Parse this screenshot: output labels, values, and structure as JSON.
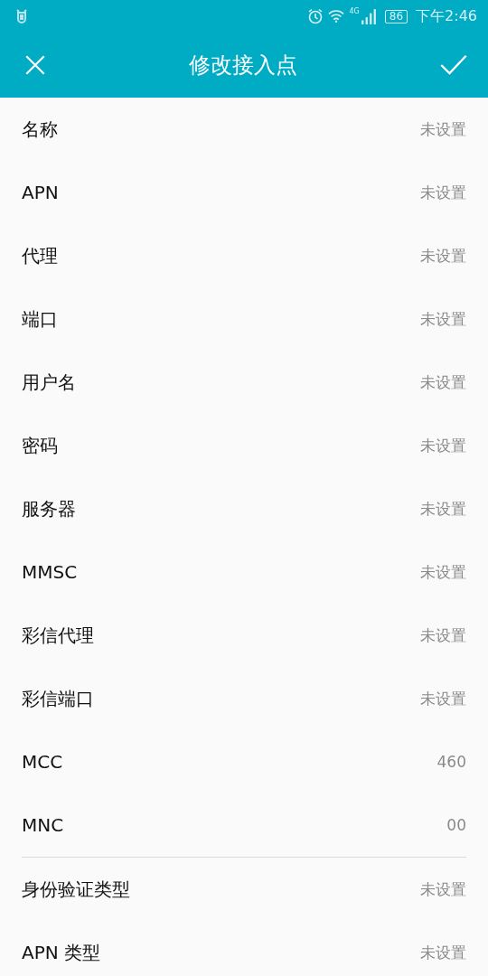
{
  "status_bar": {
    "network": "4G",
    "battery": "86",
    "time": "下午2:46"
  },
  "toolbar": {
    "title": "修改接入点"
  },
  "sections": [
    {
      "rows": [
        {
          "label": "名称",
          "value": "未设置"
        },
        {
          "label": "APN",
          "value": "未设置"
        },
        {
          "label": "代理",
          "value": "未设置"
        },
        {
          "label": "端口",
          "value": "未设置"
        },
        {
          "label": "用户名",
          "value": "未设置"
        },
        {
          "label": "密码",
          "value": "未设置"
        },
        {
          "label": "服务器",
          "value": "未设置"
        },
        {
          "label": "MMSC",
          "value": "未设置"
        },
        {
          "label": "彩信代理",
          "value": "未设置"
        },
        {
          "label": "彩信端口",
          "value": "未设置"
        },
        {
          "label": "MCC",
          "value": "460"
        },
        {
          "label": "MNC",
          "value": "00"
        }
      ]
    },
    {
      "rows": [
        {
          "label": "身份验证类型",
          "value": "未设置"
        },
        {
          "label": "APN 类型",
          "value": "未设置"
        }
      ]
    }
  ]
}
